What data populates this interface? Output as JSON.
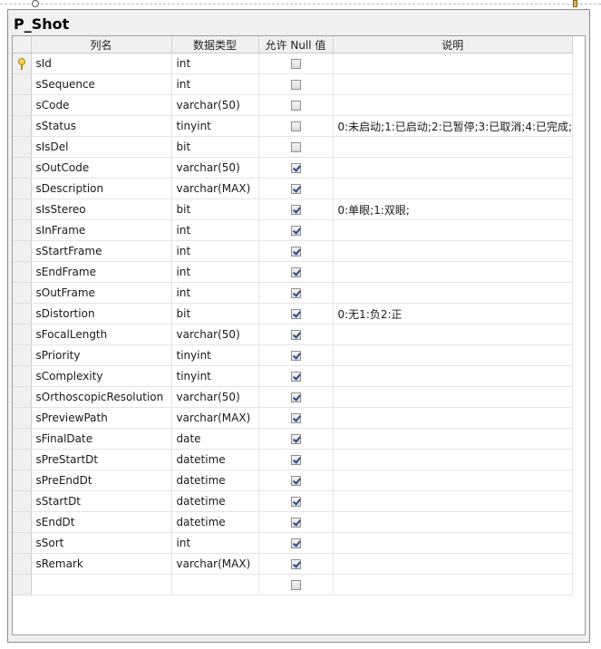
{
  "designer": {
    "table_name": "P_Shot",
    "columns_header": {
      "name": "列名",
      "type": "数据类型",
      "allow_null": "允许 Null 值",
      "description": "说明"
    },
    "rows": [
      {
        "name": "sId",
        "type": "int",
        "allow_null": false,
        "description": "",
        "primary_key": true
      },
      {
        "name": "sSequence",
        "type": "int",
        "allow_null": false,
        "description": ""
      },
      {
        "name": "sCode",
        "type": "varchar(50)",
        "allow_null": false,
        "description": ""
      },
      {
        "name": "sStatus",
        "type": "tinyint",
        "allow_null": false,
        "description": "0:未启动;1:已启动;2:已暂停;3:已取消;4:已完成;"
      },
      {
        "name": "sIsDel",
        "type": "bit",
        "allow_null": false,
        "description": ""
      },
      {
        "name": "sOutCode",
        "type": "varchar(50)",
        "allow_null": true,
        "description": ""
      },
      {
        "name": "sDescription",
        "type": "varchar(MAX)",
        "allow_null": true,
        "description": ""
      },
      {
        "name": "sIsStereo",
        "type": "bit",
        "allow_null": true,
        "description": "0:单眼;1:双眼;"
      },
      {
        "name": "sInFrame",
        "type": "int",
        "allow_null": true,
        "description": ""
      },
      {
        "name": "sStartFrame",
        "type": "int",
        "allow_null": true,
        "description": ""
      },
      {
        "name": "sEndFrame",
        "type": "int",
        "allow_null": true,
        "description": ""
      },
      {
        "name": "sOutFrame",
        "type": "int",
        "allow_null": true,
        "description": ""
      },
      {
        "name": "sDistortion",
        "type": "bit",
        "allow_null": true,
        "description": "0:无1:负2:正"
      },
      {
        "name": "sFocalLength",
        "type": "varchar(50)",
        "allow_null": true,
        "description": ""
      },
      {
        "name": "sPriority",
        "type": "tinyint",
        "allow_null": true,
        "description": ""
      },
      {
        "name": "sComplexity",
        "type": "tinyint",
        "allow_null": true,
        "description": ""
      },
      {
        "name": "sOrthoscopicResolution",
        "type": "varchar(50)",
        "allow_null": true,
        "description": ""
      },
      {
        "name": "sPreviewPath",
        "type": "varchar(MAX)",
        "allow_null": true,
        "description": ""
      },
      {
        "name": "sFinalDate",
        "type": "date",
        "allow_null": true,
        "description": ""
      },
      {
        "name": "sPreStartDt",
        "type": "datetime",
        "allow_null": true,
        "description": ""
      },
      {
        "name": "sPreEndDt",
        "type": "datetime",
        "allow_null": true,
        "description": ""
      },
      {
        "name": "sStartDt",
        "type": "datetime",
        "allow_null": true,
        "description": ""
      },
      {
        "name": "sEndDt",
        "type": "datetime",
        "allow_null": true,
        "description": ""
      },
      {
        "name": "sSort",
        "type": "int",
        "allow_null": true,
        "description": ""
      },
      {
        "name": "sRemark",
        "type": "varchar(MAX)",
        "allow_null": true,
        "description": ""
      }
    ],
    "new_row": {
      "name": "",
      "type": "",
      "allow_null": false,
      "description": ""
    }
  }
}
